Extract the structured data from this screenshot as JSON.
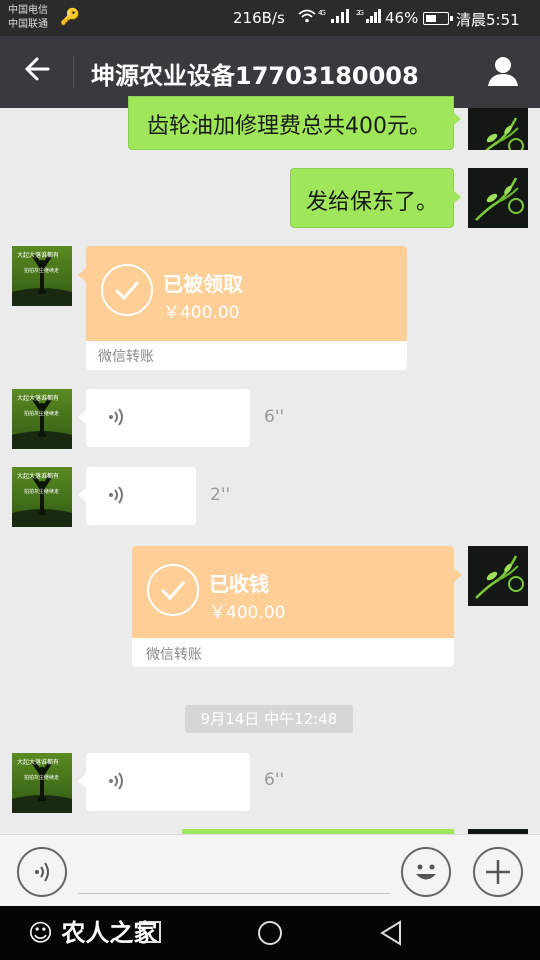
{
  "status_bar": {
    "carrier1": "中国电信",
    "carrier2": "中国联通",
    "net_speed": "216B/s",
    "battery": "46%",
    "time": "清晨5:51",
    "sig1_label": "4G",
    "sig2_label": "2G"
  },
  "header": {
    "title": "坤源农业设备17703180008"
  },
  "messages": {
    "m1_text": "齿轮油加修理费总共400元。",
    "m2_text": "发给保东了。",
    "t1_status": "已被领取",
    "t1_amount": "￥400.00",
    "t1_footer": "微信转账",
    "v1_duration": "6''",
    "v2_duration": "2''",
    "t2_status": "已收钱",
    "t2_amount": "￥400.00",
    "t2_footer": "微信转账",
    "timestamp": "9月14日 中午12:48",
    "v3_duration": "6''"
  },
  "avatar_other_text": {
    "line1": "大起大落谁都有",
    "line2": "拍拍灰尘继续走"
  },
  "watermark": "农人之家",
  "colors": {
    "header_bg": "#383a3d",
    "chat_bg": "#ebebeb",
    "sent_bubble": "#9fe65b",
    "transfer_orange": "#fdcf97"
  },
  "icons": {
    "back": "back-arrow-icon",
    "profile": "person-icon",
    "voice": "voice-icon",
    "emoji": "emoji-icon",
    "plus": "plus-icon"
  }
}
